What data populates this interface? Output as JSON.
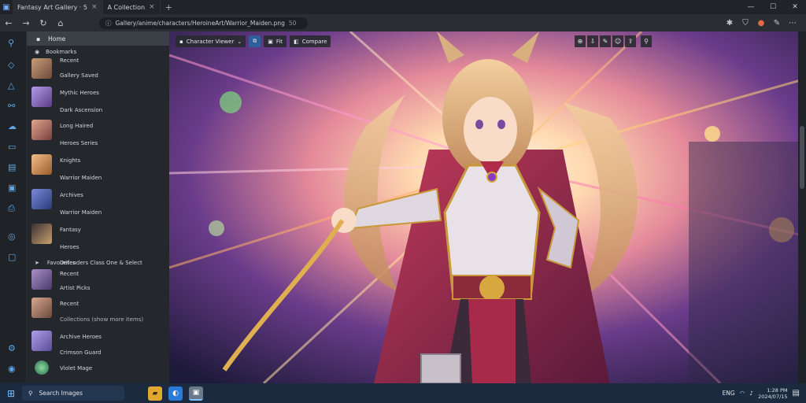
{
  "window": {
    "tabs": [
      {
        "label": "Fantasy Art Gallery · 5",
        "active": true
      },
      {
        "label": "A Collection",
        "active": false
      }
    ]
  },
  "toolbar": {
    "address": "Gallery/anime/characters/HeroineArt/Warrior_Maiden.png",
    "zoom": "50"
  },
  "sidebar": {
    "header": "Home",
    "items": [
      {
        "label": "Bookmarks"
      },
      {
        "label": "Recent"
      },
      {
        "label": "Gallery Saved"
      },
      {
        "label": "Mythic Heroes"
      },
      {
        "label": "Dark Ascension"
      },
      {
        "label": "Long Haired"
      },
      {
        "label": "Heroes Series"
      },
      {
        "label": "Knights"
      },
      {
        "label": "Warrior Maiden"
      },
      {
        "label": "Archives"
      },
      {
        "label": "Warrior Maiden"
      },
      {
        "label": "Fantasy"
      },
      {
        "label": "Heroes"
      },
      {
        "label": "Favourites"
      },
      {
        "label": "Defenders Class One & Select"
      },
      {
        "label": "Recent"
      },
      {
        "label": "Artist Picks"
      },
      {
        "label": "Recent"
      },
      {
        "label": "Collections (show more items)"
      },
      {
        "label": "Archive Heroes"
      },
      {
        "label": "Crimson Guard"
      },
      {
        "label": "Violet Mage"
      }
    ]
  },
  "content": {
    "view_label": "Character Viewer",
    "btn_fit": "Fit",
    "btn_compare": "Compare"
  },
  "taskbar": {
    "search_placeholder": "Search Images",
    "lang": "ENG",
    "time": "1:28 PM",
    "date": "2024/07/15"
  },
  "colors": {
    "accent": "#2d5f9a",
    "taskbar": "#1b2a3e"
  }
}
